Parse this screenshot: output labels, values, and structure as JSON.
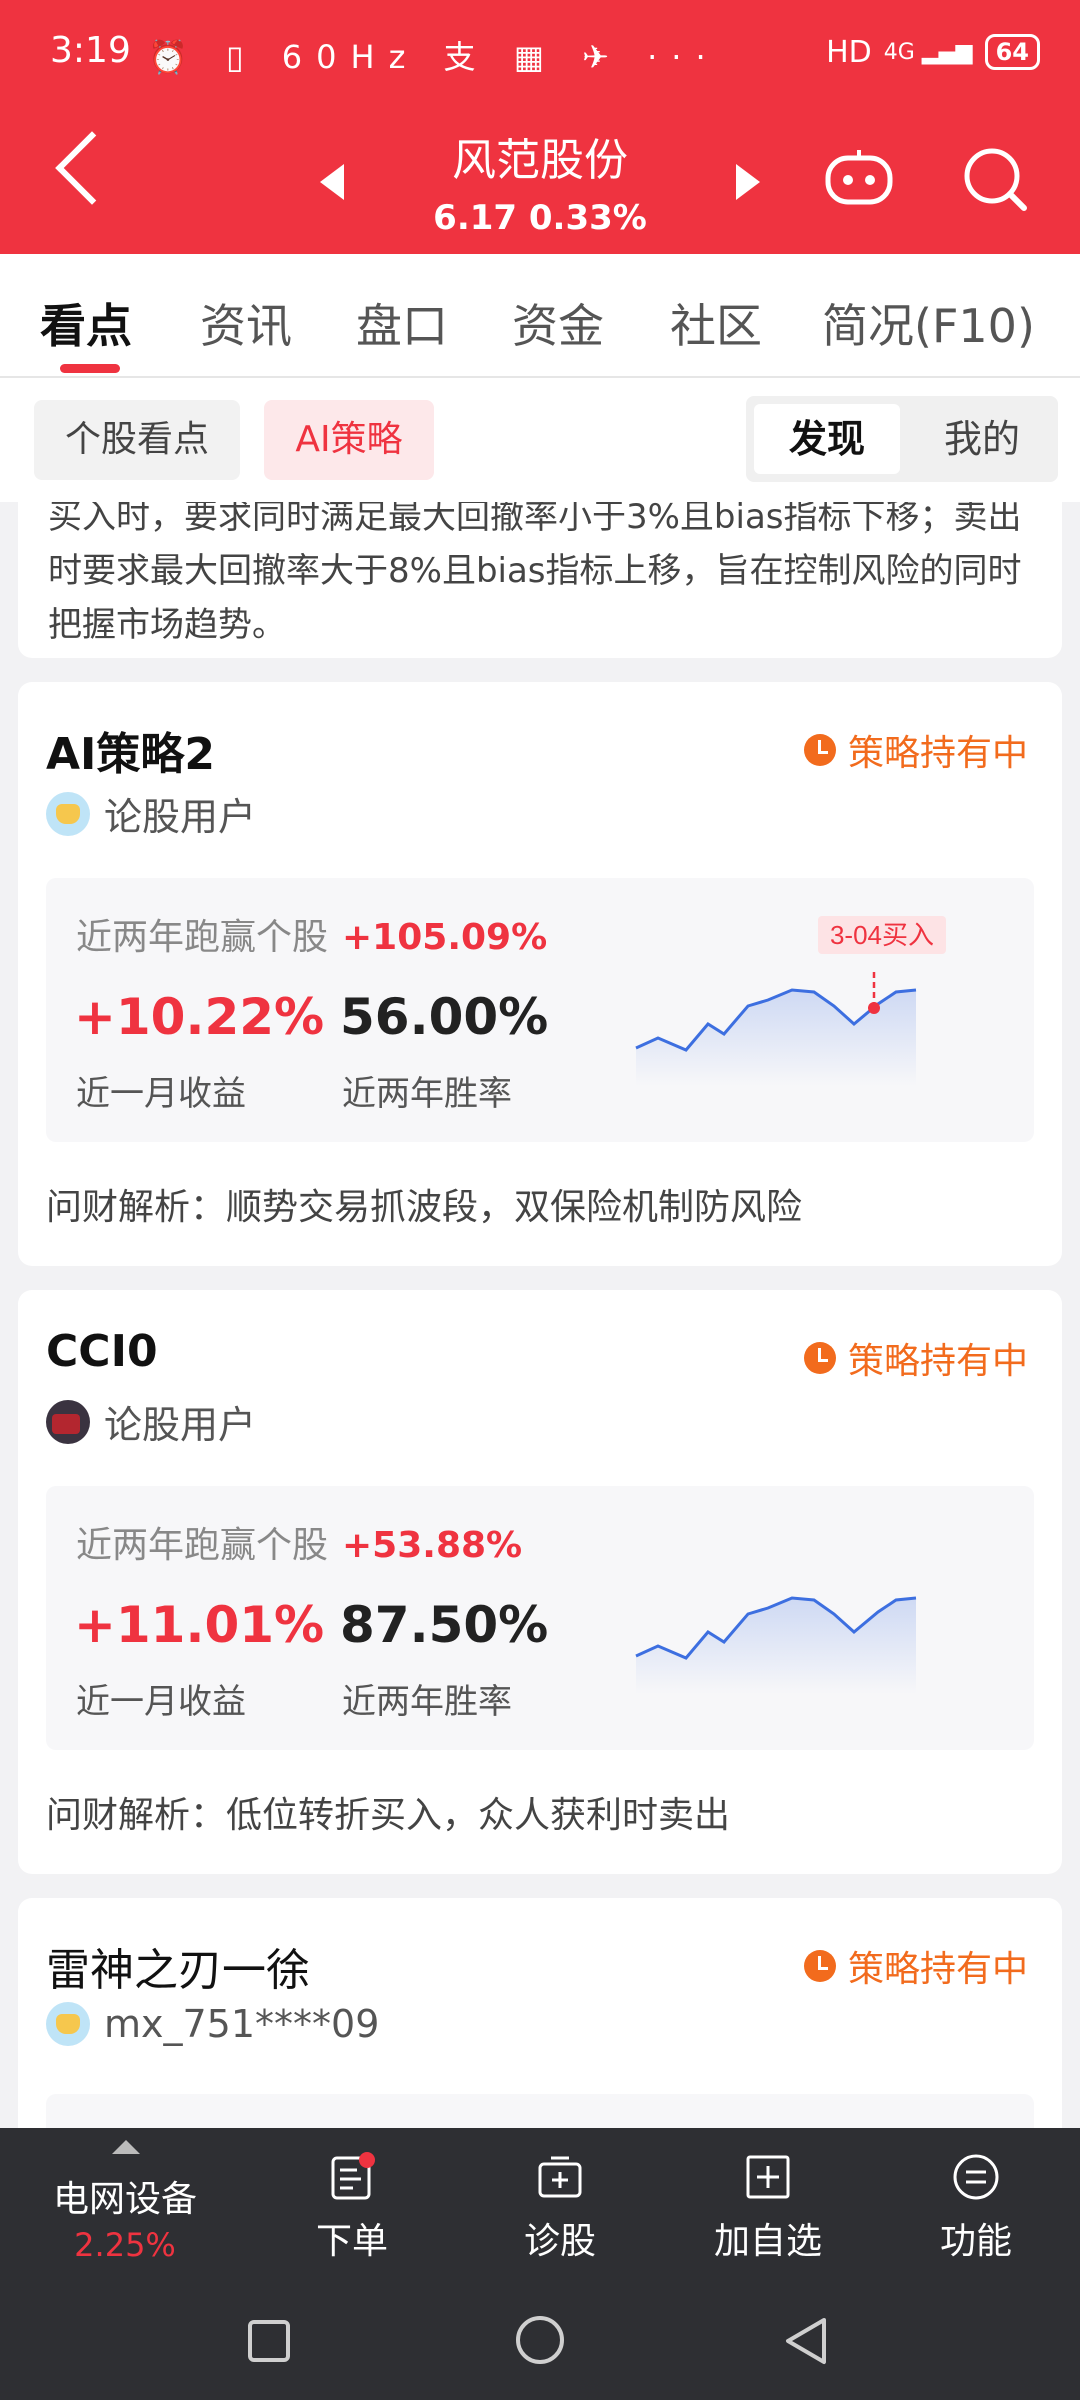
{
  "status_bar": {
    "time": "3:19",
    "left_icons": "⏰ ▯ 60Hz 支 ▦ ✈ ···",
    "network": "HD",
    "signal": "4G ▂▄▆",
    "battery": "64"
  },
  "header": {
    "stock_name": "风范股份",
    "quote": "6.17  0.33%"
  },
  "main_tabs": [
    {
      "label": "看点"
    },
    {
      "label": "资讯"
    },
    {
      "label": "盘口"
    },
    {
      "label": "资金"
    },
    {
      "label": "社区"
    },
    {
      "label": "简况(F10)"
    }
  ],
  "sub_tabs": {
    "stock_view": "个股看点",
    "ai_strategy": "AI策略",
    "discover": "发现",
    "mine": "我的"
  },
  "desc_card": {
    "text": "买入时，要求同时满足最大回撤率小于3%且bias指标下移；卖出时要求最大回撤率大于8%且bias指标上移，旨在控制风险的同时把握市场趋势。"
  },
  "strategies": [
    {
      "title": "AI策略2",
      "status": "策略持有中",
      "author": "论股用户",
      "beat_label": "近两年跑赢个股",
      "beat_value": "+105.09%",
      "monthly_return": "+10.22%",
      "monthly_return_label": "近一月收益",
      "win_rate": "56.00%",
      "win_rate_label": "近两年胜率",
      "analysis": "问财解析：顺势交易抓波段，双保险机制防风险",
      "buy_marker": "3-04买入"
    },
    {
      "title": "CCI0",
      "status": "策略持有中",
      "author": "论股用户",
      "beat_label": "近两年跑赢个股",
      "beat_value": "+53.88%",
      "monthly_return": "+11.01%",
      "monthly_return_label": "近一月收益",
      "win_rate": "87.50%",
      "win_rate_label": "近两年胜率",
      "analysis": "问财解析：低位转折买入，众人获利时卖出"
    },
    {
      "title": "雷神之刃一徐",
      "status": "策略持有中",
      "author": "mx_751****09"
    }
  ],
  "toolbar": {
    "sector_name": "电网设备",
    "sector_change": "2.25%",
    "order": "下单",
    "diagnose": "诊股",
    "add_watch": "加自选",
    "functions": "功能"
  },
  "colors": {
    "brand_red": "#ef3340",
    "status_orange": "#f26b1d",
    "line_blue": "#3d6fe0"
  }
}
